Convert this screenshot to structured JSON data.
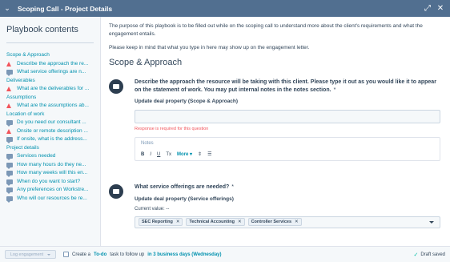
{
  "header": {
    "title": "Scoping Call - Project Details",
    "chevron_glyph": "⌄",
    "expand_glyph": "⤢",
    "close_glyph": "✕"
  },
  "sidebar": {
    "title": "Playbook contents",
    "items": [
      {
        "type": "section",
        "label": "Scope & Approach"
      },
      {
        "type": "warn",
        "label": "Describe the approach the re..."
      },
      {
        "type": "chat",
        "label": "What service offerings are n..."
      },
      {
        "type": "section",
        "label": "Deliverables"
      },
      {
        "type": "warn",
        "label": "What are the deliverables for ..."
      },
      {
        "type": "section",
        "label": "Assumptions"
      },
      {
        "type": "warn",
        "label": "What are the assumptions ab..."
      },
      {
        "type": "section",
        "label": "Location of work"
      },
      {
        "type": "chat",
        "label": "Do you need our consultant ..."
      },
      {
        "type": "warn",
        "label": "Onsite or remote description ..."
      },
      {
        "type": "chat",
        "label": "If onsite, what is the address..."
      },
      {
        "type": "section",
        "label": "Project details"
      },
      {
        "type": "chat",
        "label": "Services needed"
      },
      {
        "type": "chat",
        "label": "How many hours do they ne..."
      },
      {
        "type": "chat",
        "label": "How many weeks will this en..."
      },
      {
        "type": "chat",
        "label": "When do you want to start?"
      },
      {
        "type": "chat",
        "label": "Any preferences on Workstre..."
      },
      {
        "type": "chat",
        "label": "Who will our resources be re..."
      }
    ]
  },
  "main": {
    "intro_1": "The purpose of this playbook is to be filled out while on the scoping call to understand more about the client's requirements and what the engagement entails.",
    "intro_2": "Please keep in mind that what you type in here may show up on the engagement letter.",
    "section_title": "Scope & Approach",
    "q1": {
      "title": "Describe the approach the resource will be taking with this client. Please type it out as you would like it to appear on the statement of work. You may put internal notes in the notes section.",
      "required": "*",
      "property_label": "Update deal property (Scope & Approach)",
      "error": "Response is required for this question",
      "notes_placeholder": "Notes",
      "toolbar": {
        "bold": "B",
        "italic": "I",
        "underline": "U",
        "clear": "Tx",
        "more": "More ▾",
        "attach": "⇕",
        "list": "☰"
      }
    },
    "q2": {
      "title": "What service offerings are needed?",
      "required": "*",
      "property_label": "Update deal property (Service offerings)",
      "current_value": "Current value: --",
      "tags": [
        "SEC Reporting",
        "Technical Accounting",
        "Controller Services"
      ],
      "tag_remove": "✕"
    }
  },
  "footer": {
    "log_button": "Log engagement",
    "create_text": "Create a",
    "todo_link": "To-do",
    "task_text": "task to follow up",
    "due_link": "in 3 business days (Wednesday)",
    "saved_tick": "✓",
    "saved_text": "Draft saved"
  }
}
